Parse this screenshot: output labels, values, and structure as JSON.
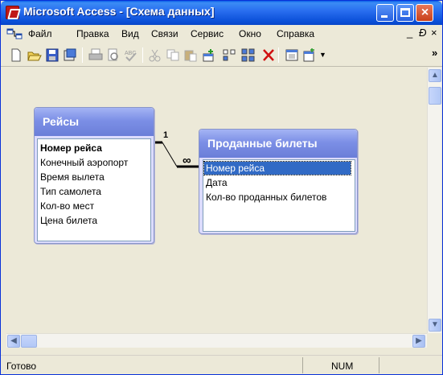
{
  "window": {
    "title": "Microsoft Access - [Схема данных]"
  },
  "menu": {
    "items": [
      "Файл",
      "Правка",
      "Вид",
      "Связи",
      "Сервис",
      "Окно",
      "Справка"
    ],
    "window_controls": {
      "minimize": "_",
      "restore": "Ɖ",
      "close": "×"
    }
  },
  "toolbar": {
    "icons": [
      "new-icon",
      "open-icon",
      "save-icon",
      "sql-icon",
      "print-icon",
      "print-preview-icon",
      "spelling-icon",
      "cut-icon",
      "copy-icon",
      "paste-icon",
      "show-table-icon",
      "show-direct-icon",
      "show-all-icon",
      "delete-icon",
      "database-window-icon",
      "new-object-icon"
    ],
    "overflow": "»"
  },
  "tables": [
    {
      "title": "Рейсы",
      "fields": [
        "Номер рейса",
        "Конечный аэропорт",
        "Время вылета",
        "Тип самолета",
        "Кол-во мест",
        "Цена билета"
      ],
      "primary_key_index": 0
    },
    {
      "title": "Проданные билеты",
      "fields": [
        "Номер рейса",
        "Дата",
        "Кол-во проданных билетов"
      ],
      "selected_index": 0
    }
  ],
  "relationship": {
    "one_label": "1",
    "many_label": "∞"
  },
  "statusbar": {
    "text": "Готово",
    "num": "NUM"
  },
  "colors": {
    "title_bar": "#2a6ff0",
    "table_header": "#7c8fe6",
    "selection": "#316ac5",
    "background": "#ece9d8"
  }
}
